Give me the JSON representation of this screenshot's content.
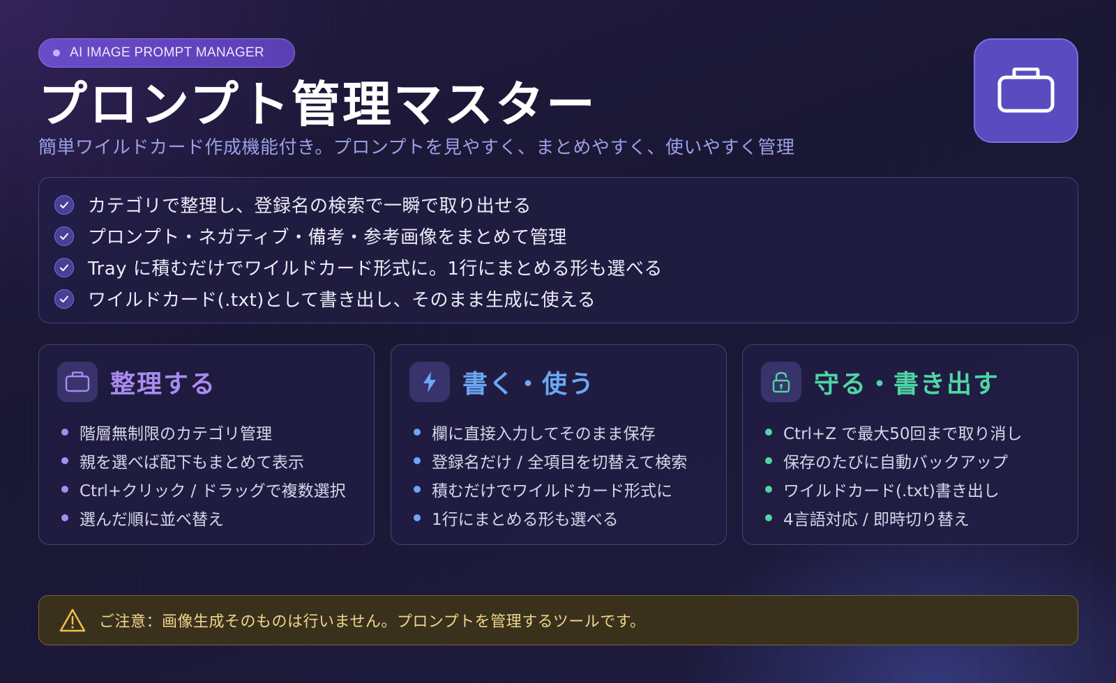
{
  "header": {
    "badge": "AI IMAGE PROMPT MANAGER",
    "title": "プロンプト管理マスター",
    "subtitle": "簡単ワイルドカード作成機能付き。プロンプトを見やすく、まとめやすく、使いやすく管理",
    "app_icon": "folder-icon"
  },
  "features": [
    "カテゴリで整理し、登録名の検索で一瞬で取り出せる",
    "プロンプト・ネガティブ・備考・参考画像をまとめて管理",
    "Tray に積むだけでワイルドカード形式に。1行にまとめる形も選べる",
    "ワイルドカード(.txt)として書き出し、そのまま生成に使える"
  ],
  "cards": [
    {
      "title": "整理する",
      "icon": "folder-icon",
      "color": "#a98cf0",
      "items": [
        "階層無制限のカテゴリ管理",
        "親を選べば配下もまとめて表示",
        "Ctrl+クリック / ドラッグで複数選択",
        "選んだ順に並べ替え"
      ]
    },
    {
      "title": "書く・使う",
      "icon": "lightning-icon",
      "color": "#6aa8f5",
      "items": [
        "欄に直接入力してそのまま保存",
        "登録名だけ / 全項目を切替えて検索",
        "積むだけでワイルドカード形式に",
        "1行にまとめる形も選べる"
      ]
    },
    {
      "title": "守る・書き出す",
      "icon": "lock-icon",
      "color": "#4fd6a4",
      "items": [
        "Ctrl+Z で最大50回まで取り消し",
        "保存のたびに自動バックアップ",
        "ワイルドカード(.txt)書き出し",
        "4言語対応 / 即時切り替え"
      ]
    }
  ],
  "notice": {
    "icon": "warning-icon",
    "text": "ご注意：画像生成そのものは行いません。プロンプトを管理するツールです。"
  }
}
